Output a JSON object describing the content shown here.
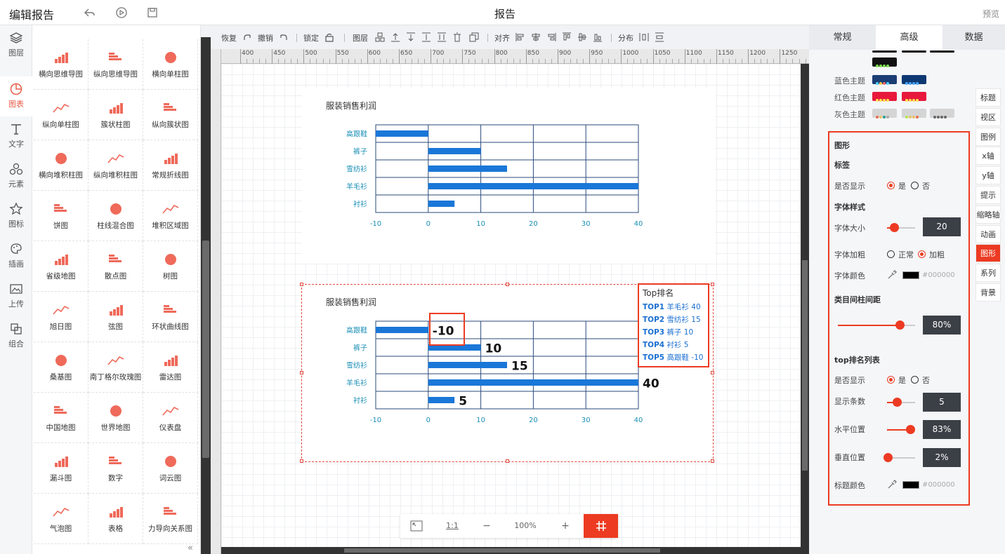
{
  "topbar": {
    "app_title": "编辑报告",
    "report_title": "报告",
    "preview": "预览"
  },
  "leftnav": [
    {
      "label": "图层",
      "icon": "layers-icon"
    },
    {
      "label": "图表",
      "icon": "chart-icon"
    },
    {
      "label": "文字",
      "icon": "text-icon"
    },
    {
      "label": "元素",
      "icon": "shapes-icon"
    },
    {
      "label": "图标",
      "icon": "star-icon"
    },
    {
      "label": "插画",
      "icon": "palette-icon"
    },
    {
      "label": "上传",
      "icon": "upload-image-icon"
    },
    {
      "label": "组合",
      "icon": "group-icon"
    }
  ],
  "gallery": [
    "横向思维导图",
    "纵向思维导图",
    "横向单柱图",
    "纵向单柱图",
    "簇状柱图",
    "纵向簇状图",
    "横向堆积柱图",
    "纵向堆积柱图",
    "常规折线图",
    "饼图",
    "柱线混合图",
    "堆积区域图",
    "省级地图",
    "散点图",
    "树图",
    "旭日图",
    "弦图",
    "环状曲线图",
    "桑基图",
    "南丁格尔玫瑰图",
    "雷达图",
    "中国地图",
    "世界地图",
    "仪表盘",
    "漏斗图",
    "数字",
    "词云图",
    "气泡图",
    "表格",
    "力导向关系图"
  ],
  "toolbar": {
    "redo": "恢复",
    "undo": "撤销",
    "lock": "锁定",
    "layer": "图层",
    "align": "对齐",
    "distribute": "分布"
  },
  "ruler": [
    "400",
    "450",
    "500",
    "550",
    "600",
    "650",
    "700",
    "750",
    "800",
    "850",
    "900",
    "950",
    "1000",
    "1050",
    "1100",
    "1150",
    "1200",
    "1250"
  ],
  "chart_data": [
    {
      "type": "bar",
      "orientation": "horizontal",
      "title": "服装销售利润",
      "categories": [
        "高跟鞋",
        "裤子",
        "雪纺衫",
        "羊毛衫",
        "衬衫"
      ],
      "values": [
        -10,
        10,
        15,
        40,
        5
      ],
      "xlim": [
        -10,
        40
      ],
      "xticks": [
        "-10",
        "0",
        "10",
        "20",
        "30",
        "40"
      ],
      "color": "#1a77d8",
      "show_labels": false
    },
    {
      "type": "bar",
      "orientation": "horizontal",
      "title": "服装销售利润",
      "categories": [
        "高跟鞋",
        "裤子",
        "雪纺衫",
        "羊毛衫",
        "衬衫"
      ],
      "values": [
        -10,
        10,
        15,
        40,
        5
      ],
      "labels": [
        "-10",
        "10",
        "15",
        "40",
        "5"
      ],
      "xlim": [
        -10,
        40
      ],
      "xticks": [
        "-10",
        "0",
        "10",
        "20",
        "30",
        "40"
      ],
      "color": "#1a77d8",
      "show_labels": true
    }
  ],
  "toplist": {
    "title": "Top排名",
    "rows": [
      {
        "rank": "TOP1",
        "text": "羊毛衫 40"
      },
      {
        "rank": "TOP2",
        "text": "雪纺衫 15"
      },
      {
        "rank": "TOP3",
        "text": "裤子 10"
      },
      {
        "rank": "TOP4",
        "text": "衬衫 5"
      },
      {
        "rank": "TOP5",
        "text": "高跟鞋 -10"
      }
    ]
  },
  "zoombar": {
    "ratio": "1:1",
    "minus": "−",
    "zoom": "100%",
    "plus": "+"
  },
  "rpanel": {
    "tabs": [
      "常规",
      "高级",
      "数据"
    ],
    "active_tab": "高级",
    "themes": [
      {
        "label": "蓝色主题"
      },
      {
        "label": "红色主题"
      },
      {
        "label": "灰色主题"
      }
    ],
    "sidetabs": [
      "标题",
      "视区",
      "图例",
      "x轴",
      "y轴",
      "提示",
      "缩略轴",
      "动画",
      "图形",
      "系列",
      "背景"
    ],
    "active_sidetab": "图形",
    "props": {
      "section": "图形",
      "label_section": "标签",
      "show_label": "是否显示",
      "yes": "是",
      "no": "否",
      "font_style": "字体样式",
      "font_size": "字体大小",
      "font_size_value": "20",
      "font_size_level": 0.25,
      "font_bold": "字体加粗",
      "normal": "正常",
      "bold": "加粗",
      "font_color": "字体颜色",
      "font_color_value": "#000000",
      "gap": "类目间柱间距",
      "gap_value": "80%",
      "gap_level": 0.8,
      "toplist_section": "top排名列表",
      "toplist_show": "是否显示",
      "rows_count": "显示条数",
      "rows_count_value": "5",
      "rows_level": 0.35,
      "h_pos": "水平位置",
      "h_pos_value": "83%",
      "h_level": 0.83,
      "v_pos": "垂直位置",
      "v_pos_value": "2%",
      "v_level": 0.02,
      "title_color": "标题颜色",
      "title_color_value": "#000000"
    }
  },
  "colors": {
    "accent": "#ec3b22",
    "bar": "#1a77d8",
    "label": "#1a8fb5"
  }
}
